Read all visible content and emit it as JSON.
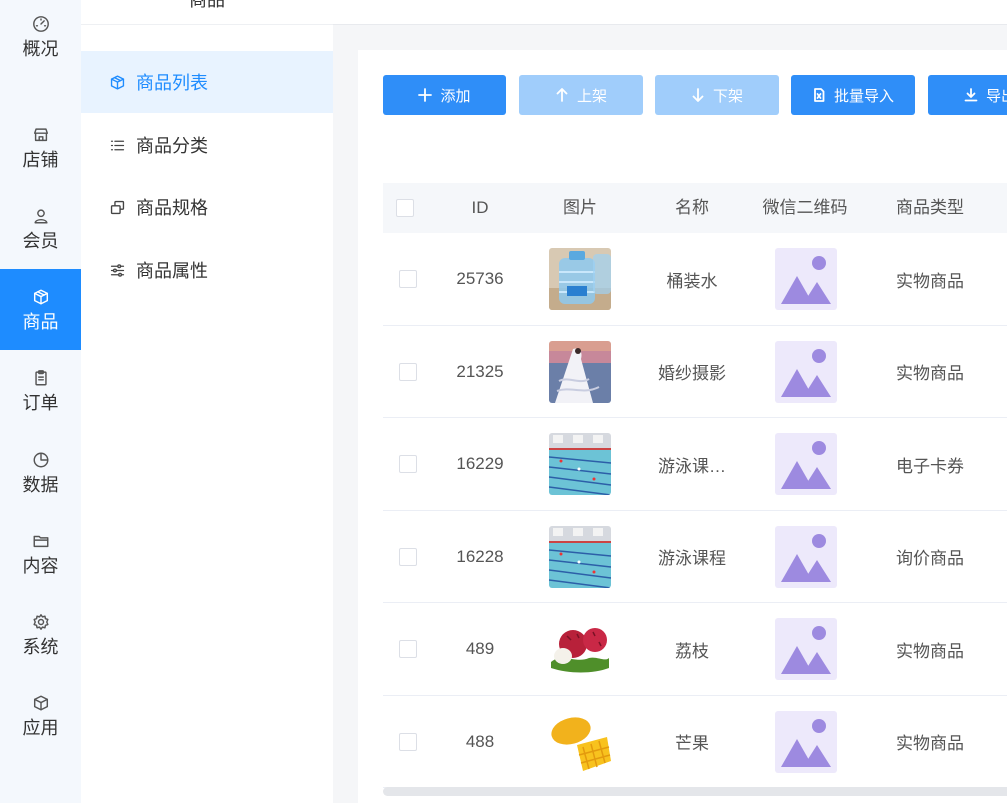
{
  "rail": {
    "items": [
      {
        "label": "概况",
        "icon": "dashboard-icon"
      },
      {
        "label": "店铺",
        "icon": "store-icon"
      },
      {
        "label": "会员",
        "icon": "user-icon"
      },
      {
        "label": "商品",
        "icon": "box-icon",
        "active": true
      },
      {
        "label": "订单",
        "icon": "clipboard-icon"
      },
      {
        "label": "数据",
        "icon": "pie-chart-icon"
      },
      {
        "label": "内容",
        "icon": "folder-icon"
      },
      {
        "label": "系统",
        "icon": "gear-icon"
      },
      {
        "label": "应用",
        "icon": "cube-icon"
      }
    ]
  },
  "submenu": {
    "title": "商品",
    "items": [
      {
        "label": "商品列表",
        "icon": "box-icon",
        "active": true
      },
      {
        "label": "商品分类",
        "icon": "list-icon"
      },
      {
        "label": "商品规格",
        "icon": "layers-icon"
      },
      {
        "label": "商品属性",
        "icon": "sliders-icon"
      }
    ]
  },
  "toolbar": {
    "add_label": "添加",
    "shelve_label": "上架",
    "unshelve_label": "下架",
    "import_label": "批量导入",
    "export_label": "导出"
  },
  "table": {
    "headers": {
      "id": "ID",
      "image": "图片",
      "name": "名称",
      "qrcode": "微信二维码",
      "type": "商品类型"
    },
    "rows": [
      {
        "id": "25736",
        "name": "桶装水",
        "type": "实物商品",
        "image": "water-bottle"
      },
      {
        "id": "21325",
        "name": "婚纱摄影",
        "type": "实物商品",
        "image": "wedding-photo"
      },
      {
        "id": "16229",
        "name": "游泳课…",
        "type": "电子卡券",
        "image": "swimming-pool"
      },
      {
        "id": "16228",
        "name": "游泳课程",
        "type": "询价商品",
        "image": "swimming-pool"
      },
      {
        "id": "489",
        "name": "荔枝",
        "type": "实物商品",
        "image": "lychee"
      },
      {
        "id": "488",
        "name": "芒果",
        "type": "实物商品",
        "image": "mango"
      }
    ]
  },
  "colors": {
    "primary": "#2f8ef8",
    "primary_disabled": "#a0cdfb",
    "active_rail": "#1e8cff",
    "active_sub_bg": "#e8f3ff",
    "qr_placeholder_bg": "#ede9fb",
    "qr_placeholder_fg": "#9d8ae0"
  }
}
